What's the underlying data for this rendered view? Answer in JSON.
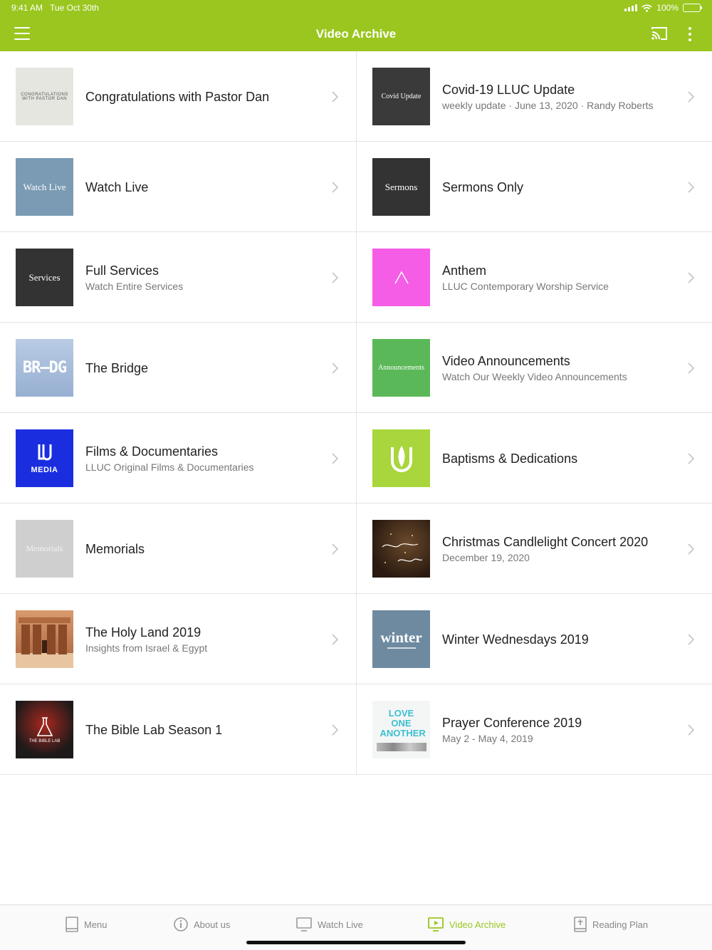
{
  "status": {
    "time": "9:41 AM",
    "date": "Tue Oct 30th",
    "battery": "100%"
  },
  "header": {
    "title": "Video Archive"
  },
  "colors": {
    "accent": "#9ac61f"
  },
  "items": [
    {
      "title": "Congratulations with Pastor Dan",
      "subtitle": "",
      "thumb_text": "CONGRATULATIONS WITH PASTOR DAN",
      "thumb_bg": "#e6e6e0",
      "thumb_fg": "#555555"
    },
    {
      "title": "Covid-19 LLUC Update",
      "subtitle": "weekly update · June 13, 2020 · Randy Roberts",
      "thumb_text": "Covid Update",
      "thumb_bg": "#3a3a3a",
      "thumb_fg": "#ffffff"
    },
    {
      "title": "Watch Live",
      "subtitle": "",
      "thumb_text": "Watch Live",
      "thumb_bg": "#7a9bb3",
      "thumb_fg": "#ffffff"
    },
    {
      "title": "Sermons Only",
      "subtitle": "",
      "thumb_text": "Sermons",
      "thumb_bg": "#333333",
      "thumb_fg": "#ffffff"
    },
    {
      "title": "Full Services",
      "subtitle": "Watch Entire Services",
      "thumb_text": "Services",
      "thumb_bg": "#333333",
      "thumb_fg": "#ffffff"
    },
    {
      "title": "Anthem",
      "subtitle": "LLUC Contemporary Worship Service",
      "thumb_text": "",
      "thumb_bg": "#f55de6",
      "thumb_fg": "#ffffff"
    },
    {
      "title": "The Bridge",
      "subtitle": "",
      "thumb_text": "",
      "thumb_bg": "#a8bedd",
      "thumb_fg": "#ffffff"
    },
    {
      "title": "Video Announcements",
      "subtitle": "Watch Our Weekly Video Announcements",
      "thumb_text": "Announcements",
      "thumb_bg": "#5bb858",
      "thumb_fg": "#ffffff"
    },
    {
      "title": "Films & Documentaries",
      "subtitle": "LLUC Original Films & Documentaries",
      "thumb_text": "MEDIA",
      "thumb_bg": "#1a2ee0",
      "thumb_fg": "#ffffff"
    },
    {
      "title": "Baptisms & Dedications",
      "subtitle": "",
      "thumb_text": "",
      "thumb_bg": "#a8d63c",
      "thumb_fg": "#ffffff"
    },
    {
      "title": "Memorials",
      "subtitle": "",
      "thumb_text": "Memorials",
      "thumb_bg": "#cfcfcf",
      "thumb_fg": "#f2f2f2"
    },
    {
      "title": "Christmas Candlelight Concert 2020",
      "subtitle": "December 19, 2020",
      "thumb_text": "",
      "thumb_bg": "#3d2a1c",
      "thumb_fg": "#ffffff"
    },
    {
      "title": "The Holy Land 2019",
      "subtitle": "Insights from Israel & Egypt",
      "thumb_text": "",
      "thumb_bg": "#c07a52",
      "thumb_fg": "#ffffff"
    },
    {
      "title": "Winter Wednesdays 2019",
      "subtitle": "",
      "thumb_text": "winter",
      "thumb_bg": "#6e8aa0",
      "thumb_fg": "#ffffff"
    },
    {
      "title": "The Bible Lab Season 1",
      "subtitle": "",
      "thumb_text": "THE BIBLE LAB",
      "thumb_bg": "#1e1a1a",
      "thumb_fg": "#ffffff"
    },
    {
      "title": "Prayer Conference 2019",
      "subtitle": "May 2 - May 4, 2019",
      "thumb_text": "LOVE ONE ANOTHER",
      "thumb_bg": "#f4f6f6",
      "thumb_fg": "#3bbfd0"
    }
  ],
  "tabs": [
    {
      "label": "Menu",
      "icon": "book-icon"
    },
    {
      "label": "About us",
      "icon": "info-icon"
    },
    {
      "label": "Watch Live",
      "icon": "monitor-icon"
    },
    {
      "label": "Video Archive",
      "icon": "video-icon",
      "active": true
    },
    {
      "label": "Reading Plan",
      "icon": "bible-icon"
    }
  ]
}
